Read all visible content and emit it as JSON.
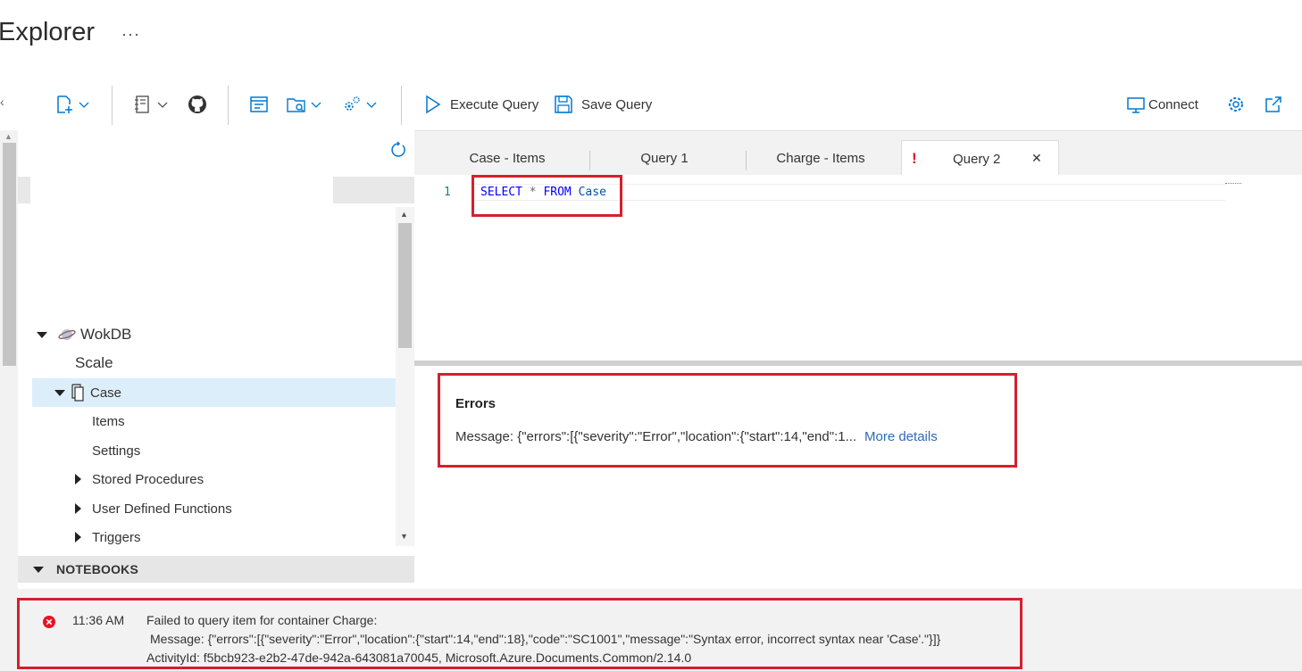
{
  "header": {
    "title": "Explorer",
    "ellipsis": "···"
  },
  "toolbar": {
    "execute_label": "Execute Query",
    "save_label": "Save Query",
    "connect_label": "Connect"
  },
  "tree": {
    "database": "WokDB",
    "scale": "Scale",
    "container": "Case",
    "items": "Items",
    "settings": "Settings",
    "stored_procedures": "Stored Procedures",
    "udfs": "User Defined Functions",
    "triggers": "Triggers",
    "notebooks": "NOTEBOOKS"
  },
  "tabs": [
    {
      "label": "Case - Items"
    },
    {
      "label": "Query 1"
    },
    {
      "label": "Charge - Items"
    },
    {
      "label": "Query 2",
      "error_mark": "!",
      "close": "✕"
    }
  ],
  "editor": {
    "line_number": "1",
    "code": {
      "kw1": "SELECT",
      "star": "*",
      "kw2": "FROM",
      "ident": "Case"
    }
  },
  "results": {
    "errors_title": "Errors",
    "message": "Message: {\"errors\":[{\"severity\":\"Error\",\"location\":{\"start\":14,\"end\":1...",
    "more_details": "More details"
  },
  "notification": {
    "time": "11:36 AM",
    "line1": "Failed to query item for container Charge:",
    "line2": "Message: {\"errors\":[{\"severity\":\"Error\",\"location\":{\"start\":14,\"end\":18},\"code\":\"SC1001\",\"message\":\"Syntax error, incorrect syntax near 'Case'.\"}]}",
    "line3": "ActivityId: f5bcb923-e2b2-47de-942a-643081a70045, Microsoft.Azure.Documents.Common/2.14.0"
  },
  "colors": {
    "accent": "#0078d4",
    "error": "#d4202c",
    "link": "#2e6bb5"
  }
}
